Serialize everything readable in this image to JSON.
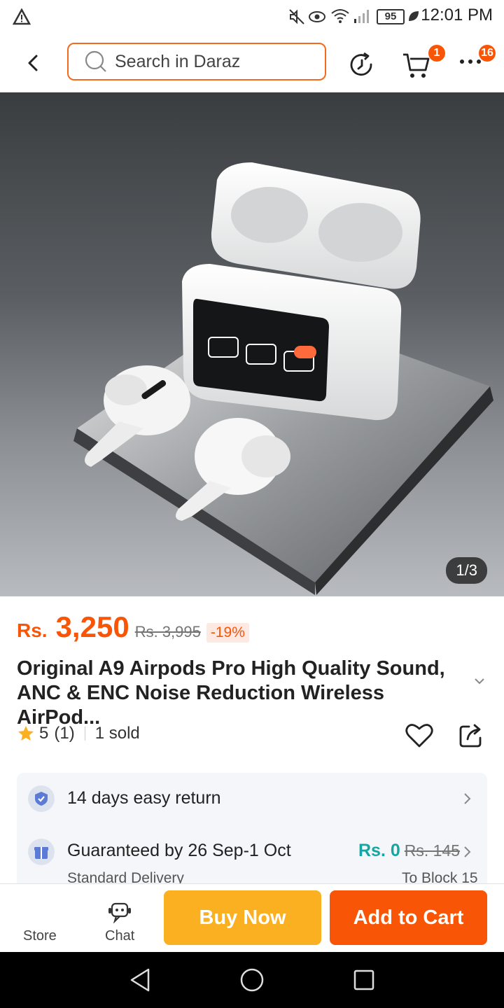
{
  "status_bar": {
    "battery": "95",
    "time": "12:01 PM"
  },
  "header": {
    "search_placeholder": "Search in Daraz",
    "cart_count": "1",
    "more_count": "16"
  },
  "gallery": {
    "counter": "1/3"
  },
  "product": {
    "currency": "Rs.",
    "price": "3,250",
    "original_price": "Rs. 3,995",
    "discount": "-19%",
    "title": "Original A9 Airpods Pro High Quality Sound, ANC & ENC Noise Reduction Wireless AirPod...",
    "rating": "5",
    "reviews": "(1)",
    "sold": "1 sold"
  },
  "service": {
    "return_text": "14 days easy return",
    "delivery_guarantee": "Guaranteed by 26 Sep-1 Oct",
    "fee": "Rs. 0",
    "fee_original": "Rs. 145",
    "delivery_type": "Standard Delivery",
    "delivery_location": "To Block 15"
  },
  "actions": {
    "store": "Store",
    "chat": "Chat",
    "buy_now": "Buy Now",
    "add_to_cart": "Add to Cart"
  },
  "colors": {
    "brand_orange": "#f85606",
    "buy_yellow": "#fbb021",
    "teal": "#14a6a2"
  },
  "icons": [
    "warning-icon",
    "mute-icon",
    "eye-icon",
    "wifi-icon",
    "signal-icon",
    "battery-icon",
    "back-icon",
    "search-icon",
    "history-icon",
    "cart-icon",
    "more-icon",
    "star-icon",
    "heart-icon",
    "share-icon",
    "shield-check-icon",
    "gift-icon",
    "chevron-right-icon",
    "chat-bot-icon",
    "nav-back-icon",
    "nav-home-icon",
    "nav-recents-icon"
  ]
}
